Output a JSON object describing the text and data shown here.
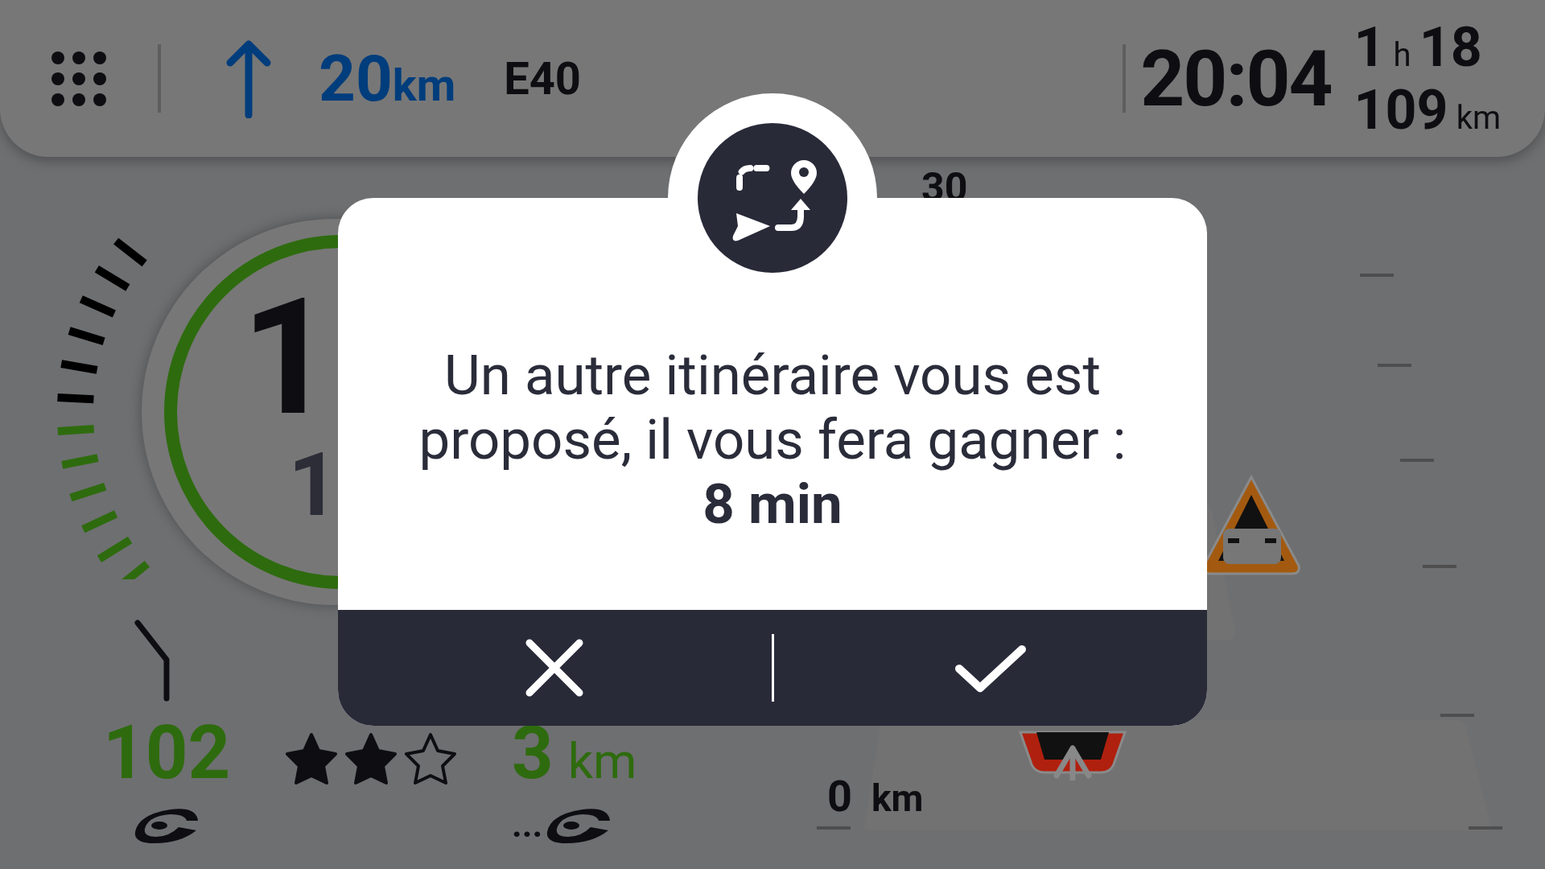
{
  "top_bar": {
    "next_distance": "20",
    "next_distance_unit": "km",
    "road": "E40",
    "arrival_time": "20:04",
    "duration_hours": "1",
    "duration_hours_unit": "h",
    "duration_minutes": "18",
    "remaining_distance": "109",
    "remaining_distance_unit": "km"
  },
  "speedometer": {
    "speed_partial": "1",
    "limit_partial": "1"
  },
  "bottom": {
    "speed": "102",
    "stars": 2,
    "alert_distance": "3",
    "alert_distance_unit": "km",
    "more": "..."
  },
  "hazard_panel": {
    "top_label": "30",
    "bottom_distance": "0",
    "bottom_distance_unit": "km"
  },
  "dialog": {
    "message": "Un autre itinéraire vous est proposé, il vous fera gagner :",
    "gain": "8 min",
    "buttons": [
      {
        "kind": "cancel"
      },
      {
        "kind": "confirm"
      }
    ]
  }
}
